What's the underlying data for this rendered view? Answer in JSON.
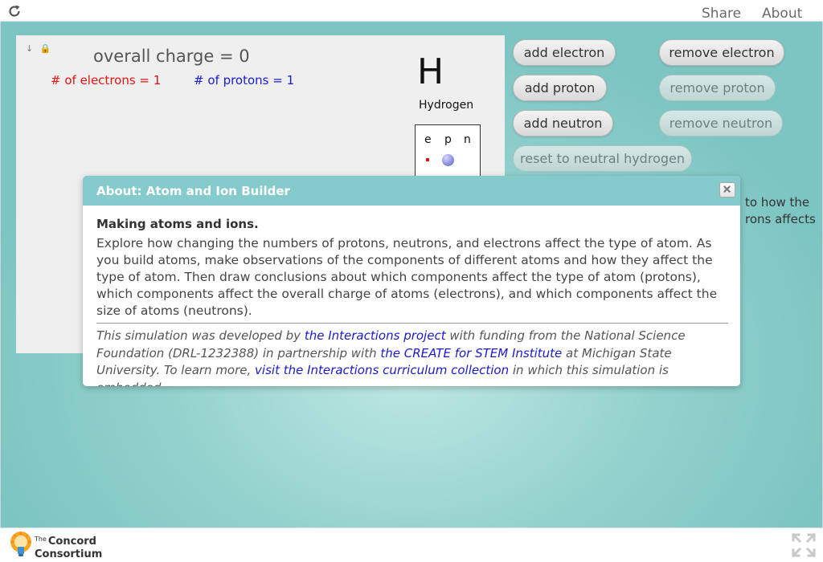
{
  "topbar": {
    "share_label": "Share",
    "about_label": "About",
    "reload_icon": "reload-icon"
  },
  "model": {
    "tools": [
      "↓",
      "🔒"
    ],
    "overall_charge": "overall charge = 0",
    "electrons_count": "# of electrons = 1",
    "protons_count": "# of protons = 1",
    "element_symbol": "H",
    "element_name": "Hydrogen",
    "legend": {
      "electron": "e",
      "proton": "p",
      "neutron": "n"
    },
    "colors": {
      "electron": "#e31414",
      "proton": "#8f92de",
      "electrons_label": "#e31414",
      "protons_label": "#1a1ad8"
    }
  },
  "controls": {
    "add_electron": "add electron",
    "remove_electron": "remove electron",
    "add_proton": "add proton",
    "remove_proton": "remove proton",
    "add_neutron": "add neutron",
    "remove_neutron": "remove neutron",
    "reset": "reset to neutral hydrogen",
    "disabled": [
      "remove proton",
      "remove neutron",
      "reset to neutral hydrogen"
    ]
  },
  "instructions": {
    "line1": "to how the",
    "line2": "rons affects"
  },
  "dialog": {
    "title": "About: Atom and Ion Builder",
    "heading": "Making atoms and ions.",
    "paragraph": "Explore how changing the numbers of protons, neutrons, and electrons affect the type of atom. As you build atoms, make observations of the components of different atoms and how they affect the type of atom. Then draw conclusions about which components affect the type of atom (protons), which components affect the overall charge of atoms (electrons), and which components affect the size of atoms (neutrons).",
    "credits": {
      "part1": "This simulation was developed by ",
      "link1": "the Interactions project",
      "part2": " with funding from the National Science Foundation (DRL-1232388) in partnership with ",
      "link2": "the CREATE for STEM Institute",
      "part3": " at Michigan State University. To learn more, ",
      "link3": "visit the Interactions curriculum collection",
      "part4": " in which this simulation is embedded."
    },
    "header_color": "#86cbcb"
  },
  "footer": {
    "logo_small": "The",
    "logo_line1": "Concord",
    "logo_line2": "Consortium"
  }
}
